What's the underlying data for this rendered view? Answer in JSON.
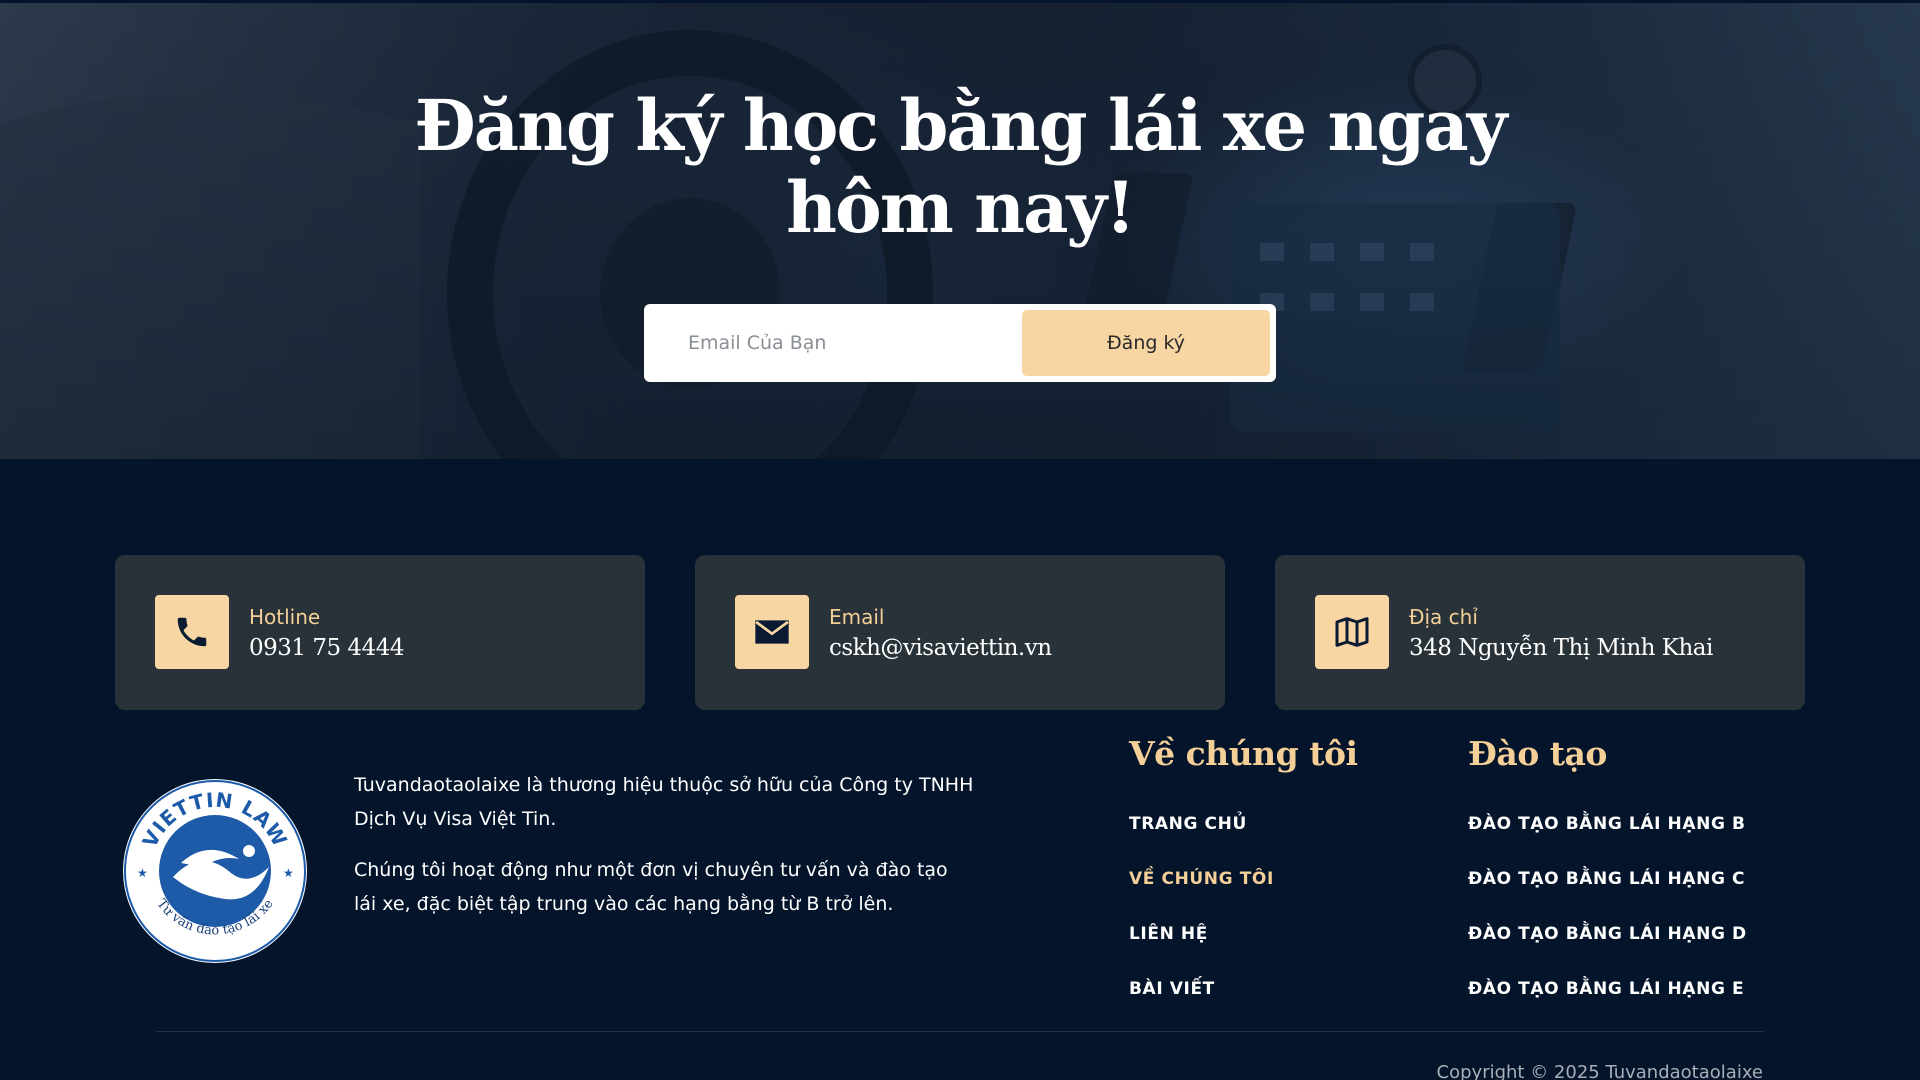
{
  "hero": {
    "title_line1": "Đăng ký học bằng lái xe ngay",
    "title_line2": "hôm nay!",
    "email_placeholder": "Email Của Bạn",
    "subscribe_label": "Đăng ký"
  },
  "contacts": [
    {
      "icon": "phone-icon",
      "label": "Hotline",
      "value": "0931 75 4444"
    },
    {
      "icon": "envelope-icon",
      "label": "Email",
      "value": "cskh@visaviettin.vn"
    },
    {
      "icon": "map-icon",
      "label": "Địa chỉ",
      "value": "348 Nguyễn Thị Minh Khai"
    }
  ],
  "about": {
    "paragraph1": "Tuvandaotaolaixe là thương hiệu thuộc sở hữu của Công ty TNHH Dịch Vụ Visa Việt Tin.",
    "paragraph2": "Chúng tôi hoạt động như một đơn vị chuyên tư vấn và đào tạo lái xe, đặc biệt tập trung vào các hạng bằng từ B trở lên."
  },
  "logo": {
    "top_text": "VIETTIN LAW",
    "bottom_text": "Tư vấn đào tạo lái xe"
  },
  "columns": {
    "about_us": {
      "heading": "Về chúng tôi",
      "links": [
        "TRANG CHỦ",
        "VỀ CHÚNG TÔI",
        "LIÊN HỆ",
        "BÀI VIẾT"
      ],
      "active_index": 1
    },
    "training": {
      "heading": "Đào tạo",
      "links": [
        "ĐÀO TẠO BẰNG LÁI HẠNG B",
        "ĐÀO TẠO BẰNG LÁI HẠNG C",
        "ĐÀO TẠO BẰNG LÁI HẠNG D",
        "ĐÀO TẠO BẰNG LÁI HẠNG E"
      ]
    }
  },
  "copyright": "Copyright © 2025 Tuvandaotaolaixe",
  "colors": {
    "accent": "#f8d6a3",
    "accent_text": "#f4cf98",
    "background": "#04142a",
    "card": "#283238"
  }
}
